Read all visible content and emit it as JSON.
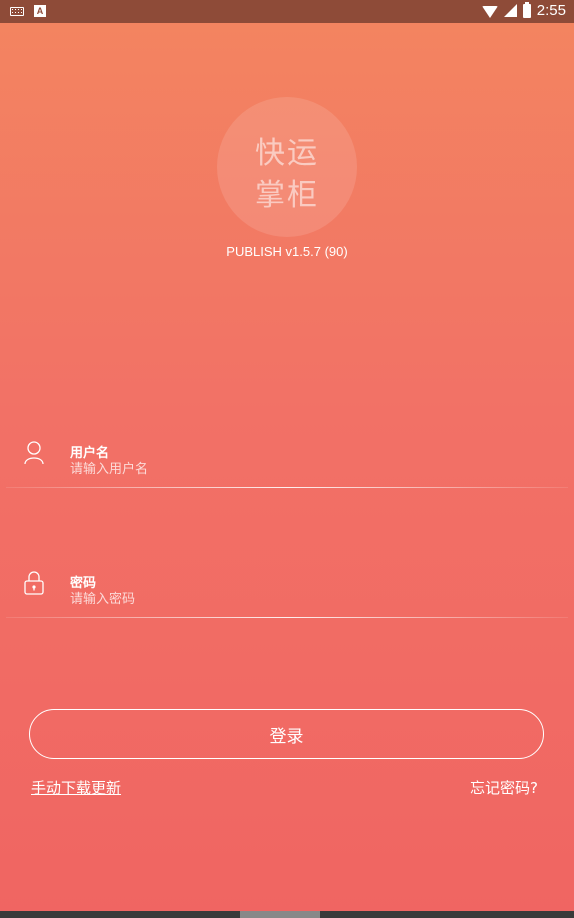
{
  "status_bar": {
    "left_icons": [
      "keyboard-icon",
      "a-icon"
    ],
    "a_glyph": "A",
    "right_icons": [
      "wifi-icon",
      "signal-icon",
      "battery-icon"
    ],
    "time": "2:55"
  },
  "logo": {
    "line1": "快运",
    "line2": "掌柜"
  },
  "version": "PUBLISH v1.5.7 (90)",
  "username": {
    "label": "用户名",
    "placeholder": "请输入用户名",
    "value": "",
    "icon": "user-icon"
  },
  "password": {
    "label": "密码",
    "placeholder": "请输入密码",
    "value": "",
    "icon": "lock-icon"
  },
  "login_button": "登录",
  "links": {
    "manual_update": "手动下载更新",
    "forgot_password": "忘记密码?"
  }
}
